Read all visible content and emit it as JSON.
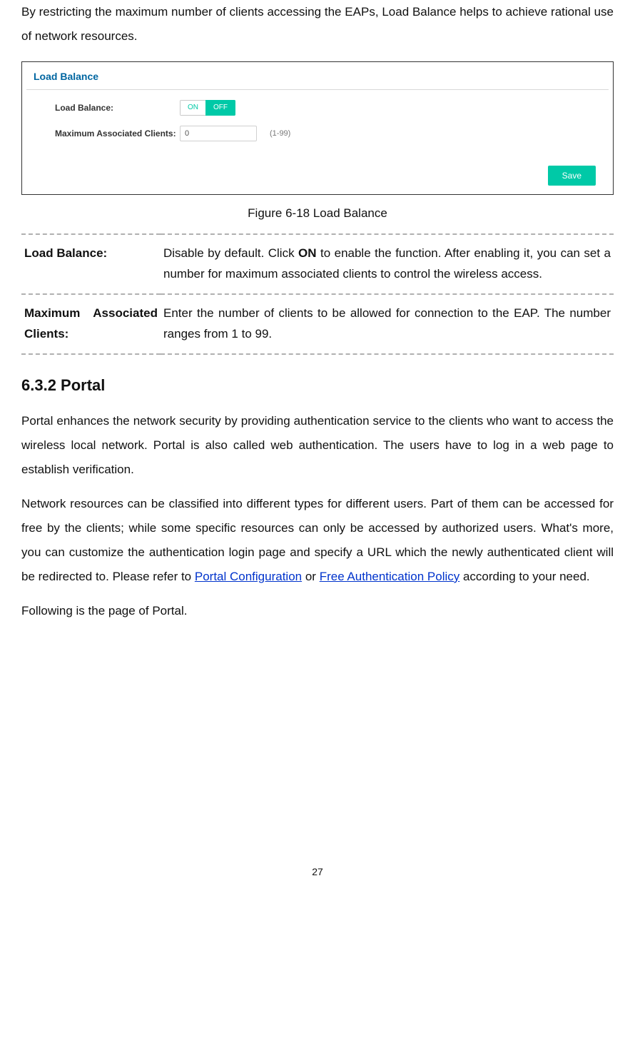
{
  "intro": "By restricting the maximum number of clients accessing the EAPs, Load Balance helps to achieve rational use of network resources.",
  "panel": {
    "title": "Load Balance",
    "row1_label": "Load Balance:",
    "toggle_on": "ON",
    "toggle_off": "OFF",
    "row2_label": "Maximum Associated Clients:",
    "input_value": "0",
    "range_hint": "(1-99)",
    "save": "Save"
  },
  "figure_caption": "Figure 6-18 Load Balance",
  "defs": {
    "r1_term": "Load Balance:",
    "r1_desc_a": "Disable by default. Click ",
    "r1_desc_b": "ON",
    "r1_desc_c": " to enable the function. After enabling it, you can set a number for maximum associated clients to control the wireless access.",
    "r2_term": "Maximum Associated Clients:",
    "r2_desc": "Enter the number of clients to be allowed for connection to the EAP. The number ranges from 1 to 99."
  },
  "subhead": "6.3.2  Portal",
  "p1": "Portal enhances the network security by providing authentication service to the clients who want to access the wireless local network. Portal is also called web authentication. The users have to log in a web page to establish verification.",
  "p2": {
    "a": "Network resources can be classified into different types for different users. Part of them can be accessed for free by the clients; while some specific resources can only be accessed by authorized users. What's more, you can customize the authentication login page and specify a URL which the newly authenticated client will be redirected to. Please refer to ",
    "link1": "Portal Configuration",
    "b": " or ",
    "link2": "Free Authentication Policy",
    "c": " according to your need."
  },
  "p3": "Following is the page of Portal.",
  "page_num": "27"
}
